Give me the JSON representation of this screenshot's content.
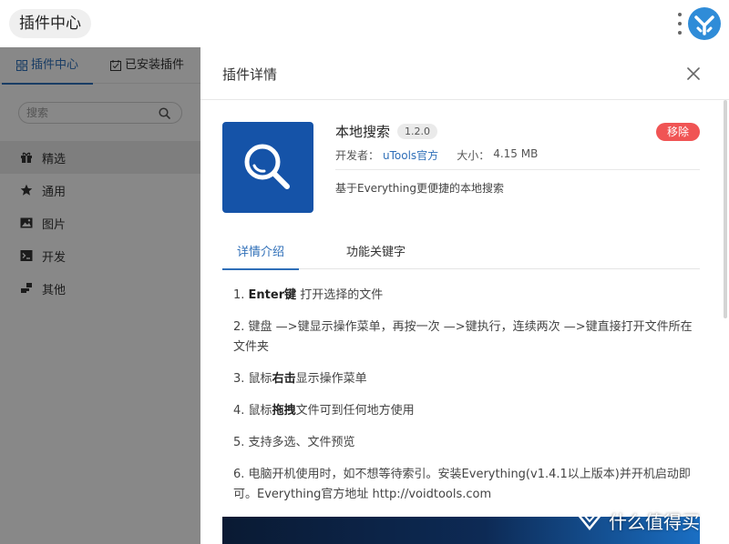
{
  "header": {
    "title": "插件中心"
  },
  "sidebar": {
    "tabs": [
      {
        "label": "插件中心",
        "icon": "grid-icon",
        "active": true
      },
      {
        "label": "已安装插件",
        "icon": "installed-icon",
        "active": false
      }
    ],
    "search": {
      "placeholder": "搜索",
      "value": ""
    },
    "categories": [
      {
        "label": "精选",
        "icon": "gift-icon",
        "active": true
      },
      {
        "label": "通用",
        "icon": "star-icon",
        "active": false
      },
      {
        "label": "图片",
        "icon": "image-icon",
        "active": false
      },
      {
        "label": "开发",
        "icon": "terminal-icon",
        "active": false
      },
      {
        "label": "其他",
        "icon": "blocks-icon",
        "active": false
      }
    ]
  },
  "detail": {
    "title": "插件详情",
    "plugin": {
      "name": "本地搜索",
      "version": "1.2.0",
      "developer_label": "开发者：",
      "developer": "uTools官方",
      "size_label": "大小：",
      "size": "4.15 MB",
      "description": "基于Everything更便捷的本地搜索",
      "remove_label": "移除"
    },
    "tabs": [
      {
        "label": "详情介绍",
        "active": true
      },
      {
        "label": "功能关键字",
        "active": false
      }
    ],
    "features": [
      {
        "num": "1. ",
        "bold": "Enter键",
        "text": " 打开选择的文件"
      },
      {
        "num": "2. ",
        "bold": "",
        "text": "键盘 —>键显示操作菜单，再按一次 —>键执行，连续两次 —>键直接打开文件所在文件夹"
      },
      {
        "num": "3. ",
        "pre": "鼠标",
        "bold": "右击",
        "text": "显示操作菜单"
      },
      {
        "num": "4. ",
        "pre": "鼠标",
        "bold": "拖拽",
        "text": "文件可到任何地方使用"
      },
      {
        "num": "5. ",
        "bold": "",
        "text": "支持多选、文件预览"
      },
      {
        "num": "6. ",
        "bold": "",
        "text": "电脑开机使用时，如不想等待索引。安装Everything(v1.4.1以上版本)并开机启动即可。Everything官方地址 http://voidtools.com"
      }
    ]
  },
  "watermark": {
    "text": "什么值得买",
    "icon": "smzdm-logo"
  },
  "colors": {
    "accent": "#2f6fb8",
    "plugin_icon_bg": "#1553a8",
    "remove_button": "#f05454"
  }
}
